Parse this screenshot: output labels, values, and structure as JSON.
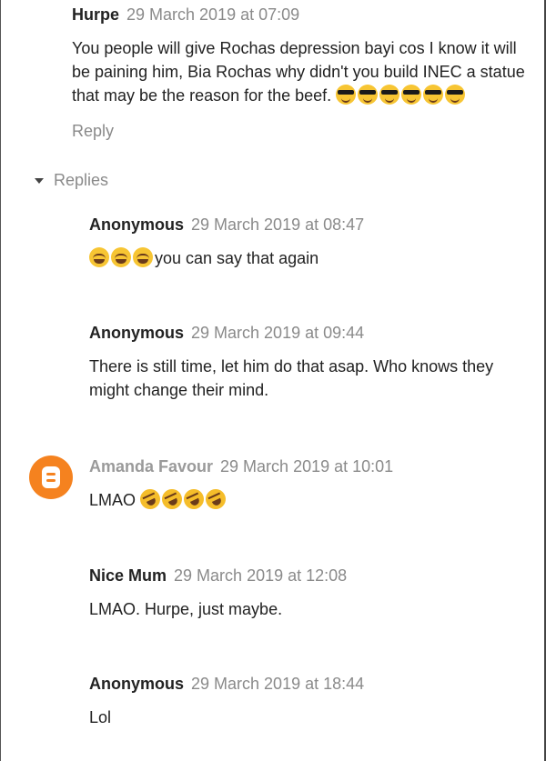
{
  "thread": {
    "top": {
      "author": "Hurpe",
      "date": "29 March 2019 at 07:09",
      "text_line1": "You people will give Rochas depression bayi cos I know it will",
      "text_line2": "be paining him, Bia Rochas why didn't you build INEC a statue",
      "text_line3": "that may be the reason for the beef.",
      "emoji": "smiling-face-with-sunglasses x6",
      "reply_label": "Reply"
    },
    "replies_label": "Replies",
    "replies": [
      {
        "author": "Anonymous",
        "date": "29 March 2019 at 08:47",
        "text": "you can say that again",
        "emoji": "smiling-face x3"
      },
      {
        "author": "Anonymous",
        "date": "29 March 2019 at 09:44",
        "text_line1": "There is still time, let him do that asap. Who knows they",
        "text_line2": "might change their mind."
      },
      {
        "author": "Amanda Favour",
        "date": "29 March 2019 at 10:01",
        "text": "LMAO",
        "emoji": "rolling-on-floor-laughing x4",
        "avatar": "blogger-icon"
      },
      {
        "author": "Nice Mum",
        "date": "29 March 2019 at 12:08",
        "text": "LMAO. Hurpe, just maybe."
      },
      {
        "author": "Anonymous",
        "date": "29 March 2019 at 18:44",
        "text": "Lol"
      }
    ]
  },
  "colors": {
    "date": "#8a8a8a",
    "avatar": "#f5821f",
    "text": "#222222"
  }
}
